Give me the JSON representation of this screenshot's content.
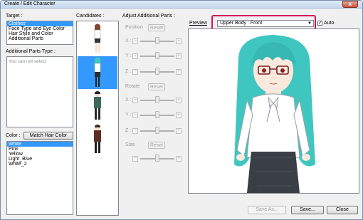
{
  "window": {
    "title": "Create / Edit Character",
    "close_glyph": "x"
  },
  "target": {
    "label": "Target :",
    "items": [
      "Clothes",
      "Face Type and Eye Color",
      "Hair Style and Color",
      "Additional Parts"
    ],
    "selected": "Clothes"
  },
  "additional_parts_type": {
    "label": "Additional Parts Type :",
    "note": "You can not select."
  },
  "color": {
    "label": "Color :",
    "match_button": "Match Hair Color",
    "items": [
      "White",
      "Pink",
      "Yellow",
      "Light_Blue",
      "White_2"
    ],
    "selected": "White"
  },
  "candidates": {
    "label": "Candidates :",
    "selected_index": 1
  },
  "adjust": {
    "label": "Adjust Additional Parts :",
    "position_label": "Position",
    "rotate_label": "Rotate",
    "size_label": "Size",
    "reset_label": "Reset",
    "x_label": "X :",
    "y_label": "Y :",
    "z_label": "Z :",
    "minus": "−",
    "plus": "+"
  },
  "preview": {
    "label": "Preview",
    "view_value": "Upper Body : Front",
    "auto_label": "Auto",
    "auto_checked": true,
    "check_glyph": "✓",
    "arrow_glyph": "▼"
  },
  "buttons": {
    "save_as": "Save As...",
    "save": "Save...",
    "close": "Close"
  },
  "colors": {
    "selection": "#3399ff",
    "highlight": "#d4145a",
    "hair": "#3fc6c0"
  }
}
